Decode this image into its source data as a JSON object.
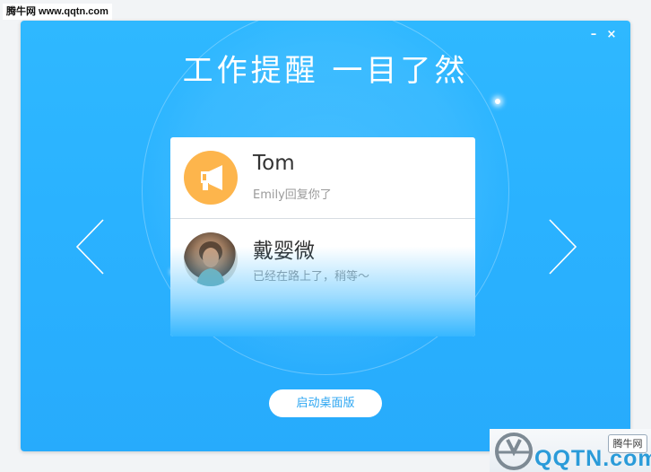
{
  "site_label": "腾牛网 www.qqtn.com",
  "window": {
    "title": "工作提醒 一目了然",
    "minimize_label": "–",
    "close_label": "×"
  },
  "notifications": [
    {
      "name": "Tom",
      "message": "Emily回复你了",
      "avatar_icon": "megaphone-icon",
      "avatar_color": "#fdb54c"
    },
    {
      "name": "戴婴微",
      "message": "已经在路上了，稍等～",
      "avatar_icon": "user-photo"
    }
  ],
  "navigation": {
    "prev_icon": "chevron-left-icon",
    "next_icon": "chevron-right-icon"
  },
  "launch_button": {
    "label": "启动桌面版"
  },
  "watermark": {
    "badge": "腾牛网",
    "logo_text": "QQTN.com"
  },
  "colors": {
    "background": "#2ab2ff",
    "accent_text": "#2ca6f2",
    "avatar_orange": "#fdb54c"
  }
}
